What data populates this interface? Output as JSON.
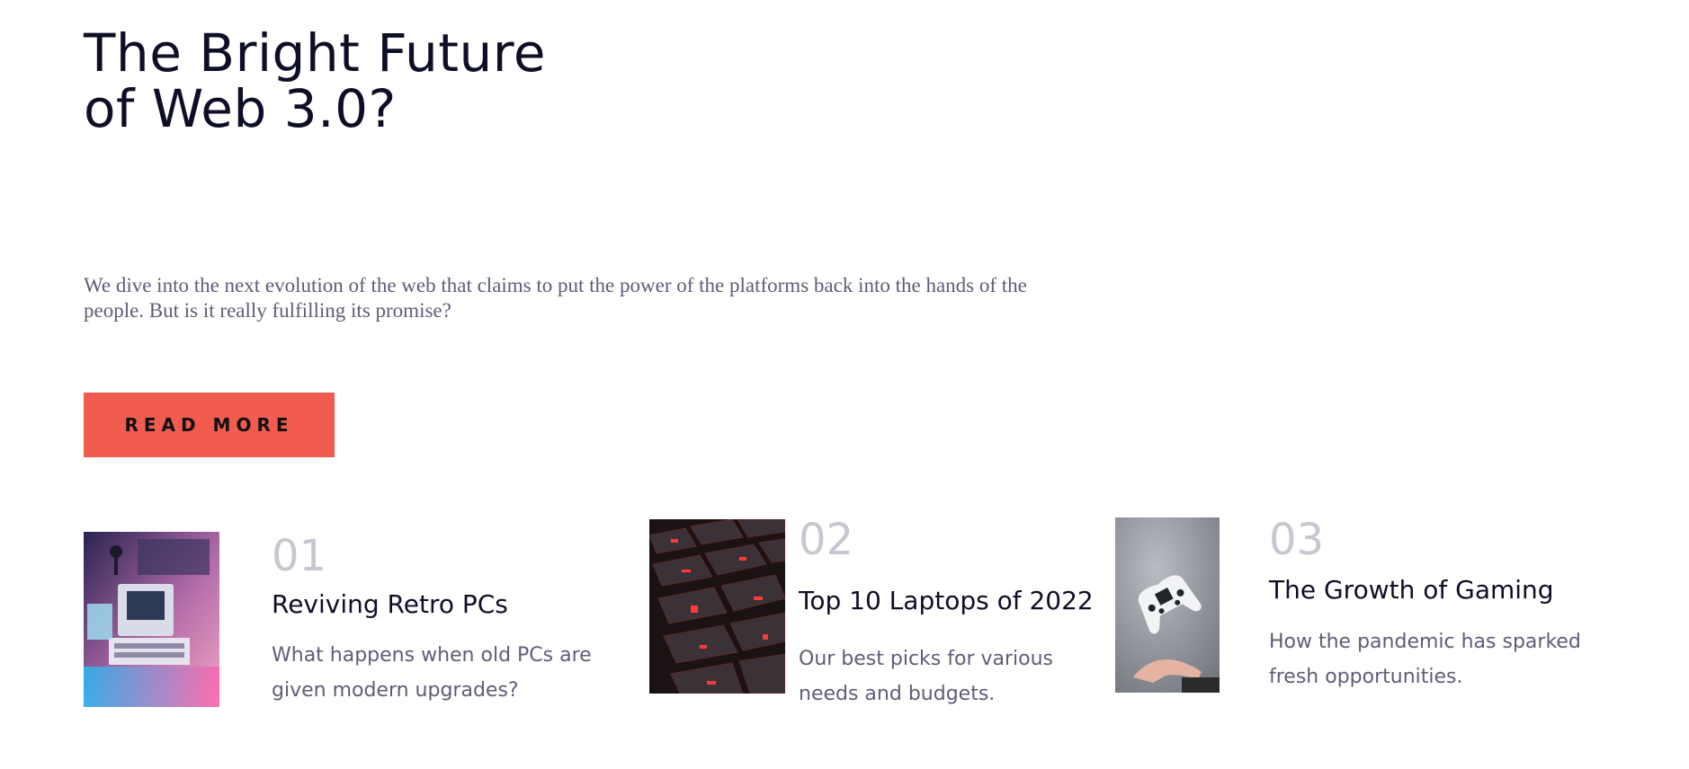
{
  "hero": {
    "title": "The Bright Future of Web 3.0?",
    "description": "We dive into the next evolution of the web that claims to put the power of the platforms back into the hands of the people. But is it really fulfilling its promise?",
    "cta_label": "READ MORE"
  },
  "posts": [
    {
      "number": "01",
      "title": "Reviving Retro PCs",
      "description": "What happens when old PCs are given modern upgrades?"
    },
    {
      "number": "02",
      "title": "Top 10 Laptops of 2022",
      "description": "Our best picks for various needs and budgets."
    },
    {
      "number": "03",
      "title": "The Growth of Gaming",
      "description": "How the pandemic has sparked fresh opportunities."
    }
  ],
  "colors": {
    "accent": "#f25c4f",
    "heading": "#0e0f26",
    "body_text": "#5d5e77",
    "number_muted": "#c6c7d1"
  }
}
